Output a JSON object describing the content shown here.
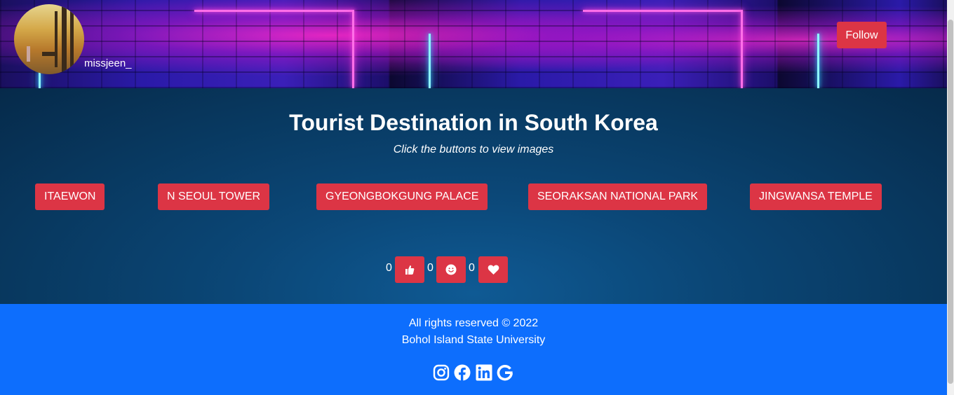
{
  "header": {
    "username": "missjeen_",
    "follow_label": "Follow"
  },
  "main": {
    "title": "Tourist Destination in South Korea",
    "subtitle": "Click the buttons to view images",
    "destinations": [
      "ITAEWON",
      "N SEOUL TOWER",
      "GYEONGBOKGUNG PALACE",
      "SEORAKSAN NATIONAL PARK",
      "JINGWANSA TEMPLE"
    ],
    "reactions": [
      {
        "icon": "thumbs-up-icon",
        "count": "0"
      },
      {
        "icon": "smile-icon",
        "count": "0"
      },
      {
        "icon": "heart-icon",
        "count": "0"
      }
    ]
  },
  "footer": {
    "copyright": "All rights reserved © 2022",
    "organization": "Bohol Island State University",
    "social_icons": [
      "instagram-icon",
      "facebook-icon",
      "linkedin-icon",
      "google-icon"
    ]
  },
  "colors": {
    "button_red": "#dc3545",
    "footer_blue": "#0d6efd"
  }
}
